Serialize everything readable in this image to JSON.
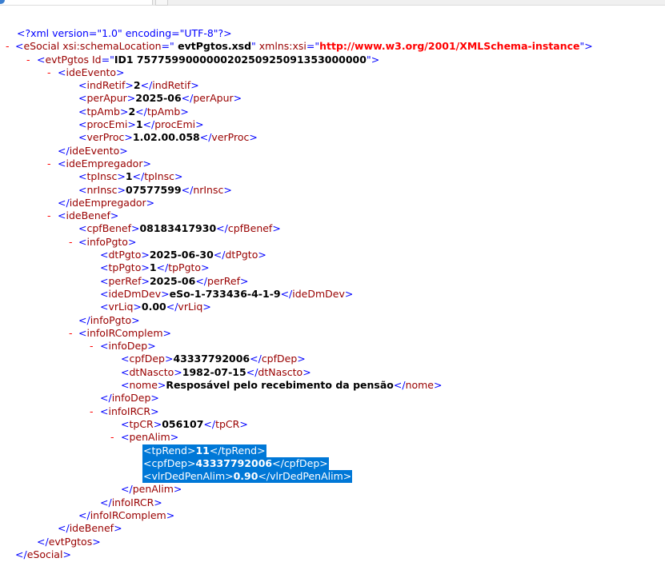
{
  "window": {
    "tab_icon": "browser-page-icon",
    "close_icon": "close-icon"
  },
  "colors": {
    "bracket": "#0000ff",
    "tag": "#990000",
    "toggle": "#ff0000",
    "url": "#ff0000",
    "selection": "#0078d7"
  },
  "toggle_symbol": "-",
  "xml_decl": "<?xml version=\"1.0\" encoding=\"UTF-8\"?>",
  "esocial": {
    "name": "eSocial",
    "attr1_name": "xsi:schemaLocation",
    "attr1_value": " evtPgtos.xsd",
    "attr2_name": "xmlns:xsi",
    "attr2_value": "http://www.w3.org/2001/XMLSchema-instance"
  },
  "evtPgtos": {
    "name": "evtPgtos",
    "attr_name": "Id",
    "attr_value": "ID1 757759900000020250925091353000000"
  },
  "tags": {
    "ideEvento": "ideEvento",
    "indRetif": "indRetif",
    "perApur": "perApur",
    "tpAmb": "tpAmb",
    "procEmi": "procEmi",
    "verProc": "verProc",
    "ideEmpregador": "ideEmpregador",
    "tpInsc": "tpInsc",
    "nrInsc": "nrInsc",
    "ideBenef": "ideBenef",
    "cpfBenef": "cpfBenef",
    "infoPgto": "infoPgto",
    "dtPgto": "dtPgto",
    "tpPgto": "tpPgto",
    "perRef": "perRef",
    "ideDmDev": "ideDmDev",
    "vrLiq": "vrLiq",
    "infoIRComplem": "infoIRComplem",
    "infoDep": "infoDep",
    "cpfDep": "cpfDep",
    "dtNascto": "dtNascto",
    "nome": "nome",
    "infoIRCR": "infoIRCR",
    "tpCR": "tpCR",
    "penAlim": "penAlim",
    "tpRend": "tpRend",
    "vlrDedPenAlim": "vlrDedPenAlim"
  },
  "values": {
    "indRetif": "2",
    "perApur": "2025-06",
    "tpAmb": "2",
    "procEmi": "1",
    "verProc": "1.02.00.058",
    "tpInsc": "1",
    "nrInsc": "07577599",
    "cpfBenef": "08183417930",
    "dtPgto": "2025-06-30",
    "tpPgto": "1",
    "perRef": "2025-06",
    "ideDmDev": "eSo-1-733436-4-1-9",
    "vrLiq": "0.00",
    "infoDep_cpfDep": "43337792006",
    "dtNascto": "1982-07-15",
    "nome": "Resposável pelo recebimento da pensão",
    "tpCR": "056107",
    "tpRend": "11",
    "penAlim_cpfDep": "43337792006",
    "vlrDedPenAlim": "0.90"
  }
}
